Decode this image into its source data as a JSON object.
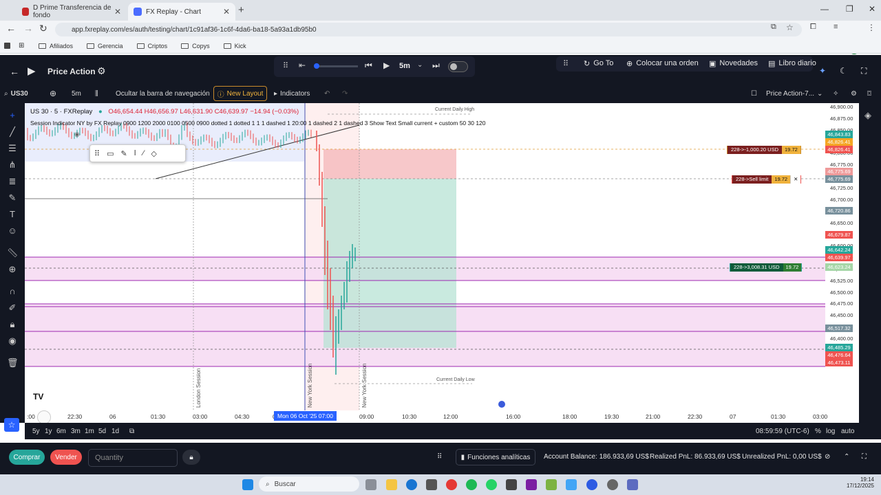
{
  "browser": {
    "tabs": [
      {
        "label": "D Prime Transferencia de fondo"
      },
      {
        "label": "FX Replay - Chart"
      }
    ],
    "url": "app.fxreplay.com/es/auth/testing/chart/1c91af36-1c6f-4da6-ba18-5a93a1db95b0",
    "bookmarks": [
      "Afiliados",
      "Gerencia",
      "Criptos",
      "Copys",
      "Kick"
    ],
    "profile_initial": "A"
  },
  "app": {
    "title": "Price Action",
    "timeframe": "5m",
    "header_buttons": {
      "goto": "Go To",
      "order": "Colocar una orden",
      "news": "Novedades",
      "journal": "Libro diario"
    }
  },
  "toolbar": {
    "symbol": "US30",
    "interval": "5m",
    "hide_nav": "Ocultar la barra de navegación",
    "new_layout": "New Layout",
    "indicators": "Indicators",
    "template": "Price Action-7..."
  },
  "chart": {
    "legend_title": "US 30 · 5 · FXReplay",
    "legend_ohlc": "O46,654.44 H46,656.97 L46,631.90 C46,639.97 −14.94 (−0.03%)",
    "session_line": "Session Indicator NY by FX Replay 0900 1200 2000 0100 0500 0900 dotted 1 dotted 1 1 1 dashed 1 20:00 1 dashed 2 1 dashed 3 Show Text Small current + custom 50 30 120",
    "current_daily_high": "Current Daily High",
    "current_daily_low": "Current Daily Low",
    "session_labels": [
      "London Session",
      "New York Session",
      "New York Session"
    ],
    "price_axis": [
      "46,900.00",
      "46,875.00",
      "46,850.00",
      "46,825.00",
      "46,800.00",
      "46,775.00",
      "46,750.00",
      "46,725.00",
      "46,700.00",
      "46,675.00",
      "46,650.00",
      "46,625.00",
      "46,600.00",
      "46,575.00",
      "46,550.00",
      "46,525.00",
      "46,500.00",
      "46,475.00",
      "46,450.00",
      "46,425.00",
      "46,400.00"
    ],
    "price_labels": [
      {
        "text": "46,843.83",
        "color": "#26a69a"
      },
      {
        "text": "46,826.41",
        "color": "#f5a623"
      },
      {
        "text": "46,826.41",
        "color": "#ef5350"
      },
      {
        "text": "46,775.69",
        "color": "#ef9a9a"
      },
      {
        "text": "46,775.69",
        "color": "#78909c"
      },
      {
        "text": "46,720.86",
        "color": "#78909c"
      },
      {
        "text": "46,679.87",
        "color": "#ef5350"
      },
      {
        "text": "46,642.24",
        "color": "#26a69a"
      },
      {
        "text": "46,639.97",
        "color": "#ef5350"
      },
      {
        "text": "46,623.24",
        "color": "#a5d6a7"
      },
      {
        "text": "46,517.32",
        "color": "#78909c"
      },
      {
        "text": "46,485.29",
        "color": "#26a69a"
      },
      {
        "text": "46,476.64",
        "color": "#ef5350"
      },
      {
        "text": "46,473.11",
        "color": "#ef5350"
      }
    ],
    "orders": [
      {
        "label": "228->-1,000.20 USD",
        "qty": "19.72",
        "color": "#7b1f1f"
      },
      {
        "label": "228->Sell limit",
        "qty": "19.72",
        "color": "#7b1f1f"
      },
      {
        "label": "228->3,008.31 USD",
        "qty": "19.72",
        "color": "#0f5b3a"
      }
    ],
    "time_axis": [
      ":00",
      "22:30",
      "06",
      "01:30",
      "03:00",
      "04:30",
      "0",
      "09:00",
      "10:30",
      "12:00",
      "16:00",
      "18:00",
      "19:30",
      "21:00",
      "22:30",
      "07",
      "01:30",
      "03:00"
    ],
    "current_time_label": "Mon 06 Oct '25  07:00"
  },
  "rangebar": {
    "ranges": [
      "5y",
      "1y",
      "6m",
      "3m",
      "1m",
      "5d",
      "1d"
    ],
    "clock": "08:59:59 (UTC-6)",
    "pct": "%",
    "log": "log",
    "auto": "auto"
  },
  "trade": {
    "buy": "Comprar",
    "sell": "Vender",
    "quantity_placeholder": "Quantity",
    "analytics": "Funciones analíticas",
    "account_balance": "Account Balance: 186.933,69 US$",
    "realized_pnl": "Realized PnL: 86.933,69 US$",
    "unrealized_pnl": "Unrealized PnL: 0,00 US$"
  },
  "taskbar": {
    "search": "Buscar",
    "time": "19:14",
    "date": "17/12/2025"
  }
}
